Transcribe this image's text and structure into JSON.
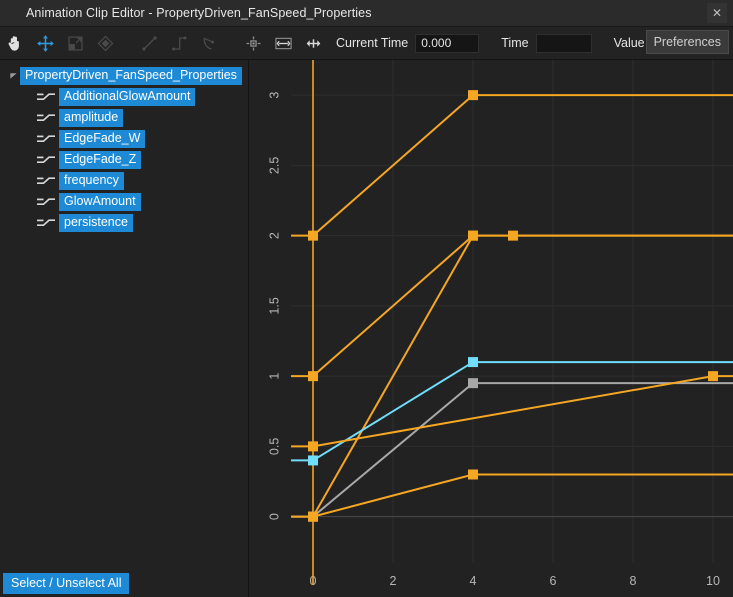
{
  "window": {
    "title": "Animation Clip Editor - PropertyDriven_FanSpeed_Properties",
    "close_label": "✕"
  },
  "toolbar": {
    "tools": [
      {
        "name": "pan-hand-icon",
        "label": "Pan"
      },
      {
        "name": "move-arrows-icon",
        "label": "Move"
      },
      {
        "name": "scale-box-icon",
        "label": "Scale"
      },
      {
        "name": "keyframe-diamond-icon",
        "label": "Keyframe"
      },
      {
        "name": "linear-tangent-icon",
        "label": "Linear"
      },
      {
        "name": "step-tangent-icon",
        "label": "Step"
      },
      {
        "name": "smooth-tangent-icon",
        "label": "Smooth"
      },
      {
        "name": "snap-center-icon",
        "label": "Snap"
      },
      {
        "name": "fit-horizontal-icon",
        "label": "Fit Horizontal"
      },
      {
        "name": "expand-range-icon",
        "label": "Expand Range"
      }
    ],
    "current_time_label": "Current Time",
    "current_time_value": "0.000",
    "time_label": "Time",
    "time_value": "",
    "value_label": "Value",
    "value_value": "",
    "preferences_label": "Preferences"
  },
  "sidebar": {
    "root": {
      "label": "PropertyDriven_FanSpeed_Properties",
      "expanded": true
    },
    "items": [
      {
        "label": "AdditionalGlowAmount"
      },
      {
        "label": "amplitude"
      },
      {
        "label": "EdgeFade_W"
      },
      {
        "label": "EdgeFade_Z"
      },
      {
        "label": "frequency"
      },
      {
        "label": "GlowAmount"
      },
      {
        "label": "persistence"
      }
    ],
    "select_all_label": "Select / Unselect All"
  },
  "colors": {
    "accent": "#1e8ad6",
    "curve_orange": "#f5a623",
    "curve_cyan": "#70ddfa",
    "curve_gray": "#a8a8a8",
    "background": "#222222",
    "grid": "#2e2e2e"
  },
  "chart_data": {
    "type": "line",
    "title": "",
    "xlabel": "",
    "ylabel": "",
    "xlim": [
      -0.55,
      10.5
    ],
    "ylim": [
      -0.33,
      3.25
    ],
    "xticks": [
      0,
      2,
      4,
      6,
      8,
      10
    ],
    "yticks": [
      0,
      0.5,
      1,
      1.5,
      2,
      2.5,
      3
    ],
    "xtick_labels": [
      "0",
      "2",
      "4",
      "6",
      "8",
      "10"
    ],
    "ytick_labels": [
      "0",
      "0.5",
      "1",
      "1.5",
      "2",
      "2.5",
      "3"
    ],
    "grid": true,
    "legend": "none",
    "playhead_x": 0,
    "series": [
      {
        "name": "amplitude",
        "color": "#f5a623",
        "keyframes": [
          [
            0,
            2
          ],
          [
            4,
            3
          ]
        ],
        "extend_right_to": 10.5,
        "extend_left_to": -0.55
      },
      {
        "name": "AdditionalGlowAmount",
        "color": "#f5a623",
        "keyframes": [
          [
            0,
            1
          ],
          [
            4,
            2
          ]
        ],
        "extend_right_to": 10.5,
        "extend_left_to": -0.55
      },
      {
        "name": "frequency",
        "color": "#f5a623",
        "keyframes": [
          [
            0,
            0
          ],
          [
            4,
            2
          ],
          [
            5,
            2
          ]
        ],
        "extend_right_to": 10.5,
        "extend_left_to": -0.55
      },
      {
        "name": "EdgeFade_W",
        "color": "#70ddfa",
        "keyframes": [
          [
            0,
            0.4
          ],
          [
            4,
            1.1
          ]
        ],
        "extend_right_to": 10.5,
        "extend_left_to": -0.55
      },
      {
        "name": "EdgeFade_Z",
        "color": "#a8a8a8",
        "keyframes": [
          [
            0,
            0
          ],
          [
            4,
            0.95
          ]
        ],
        "extend_right_to": 10.5,
        "extend_left_to": -0.55
      },
      {
        "name": "GlowAmount",
        "color": "#f5a623",
        "keyframes": [
          [
            0,
            0.5
          ],
          [
            10,
            1.0
          ]
        ],
        "extend_right_to": 10.5,
        "extend_left_to": -0.55
      },
      {
        "name": "persistence",
        "color": "#f5a623",
        "keyframes": [
          [
            0,
            0
          ],
          [
            4,
            0.3
          ]
        ],
        "extend_right_to": 10.5,
        "extend_left_to": -0.55
      }
    ]
  }
}
